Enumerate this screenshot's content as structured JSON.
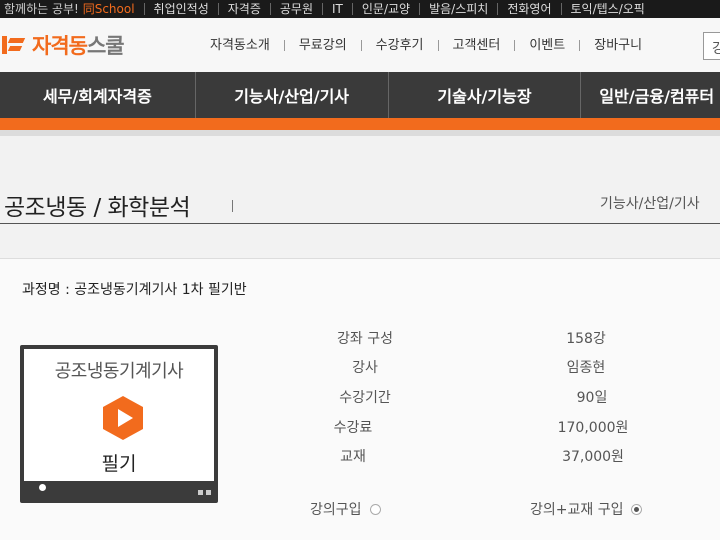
{
  "topbar": {
    "promo_prefix": "함께하는 공부!",
    "promo_brand": "同School",
    "items": [
      "취업인적성",
      "자격증",
      "공무원",
      "IT",
      "인문/교양",
      "발음/스피치",
      "전화영어",
      "토익/텝스/오픽"
    ]
  },
  "header": {
    "logo_main": "자격동",
    "logo_sub": "스쿨",
    "gnb": [
      "자격동소개",
      "무료강의",
      "수강후기",
      "고객센터",
      "이벤트",
      "장바구니"
    ],
    "search_char": "강"
  },
  "categories": [
    "세무/회계자격증",
    "기능사/산업/기사",
    "기술사/기능장",
    "일반/금융/컴퓨터"
  ],
  "page": {
    "title": "공조냉동 / 화학분석",
    "breadcrumb": "기능사/산업/기사"
  },
  "course": {
    "name_line": "과정명 : 공조냉동기계기사 1차 필기반",
    "thumb_title": "공조냉동기계기사",
    "thumb_sub": "필기",
    "info": [
      {
        "label": "강좌 구성",
        "value": "158강"
      },
      {
        "label": "강사",
        "value": "임종현"
      },
      {
        "label": "수강기간",
        "value": "90일"
      },
      {
        "label": "수강료",
        "value": "170,000원"
      },
      {
        "label": "교재",
        "value": "37,000원"
      }
    ],
    "options": [
      {
        "label": "강의구입",
        "checked": false
      },
      {
        "label": "강의+교재 구입",
        "checked": true
      }
    ]
  },
  "colors": {
    "accent": "#f26b1d",
    "nav": "#3a3a3a",
    "topbar": "#1a1a1a"
  }
}
